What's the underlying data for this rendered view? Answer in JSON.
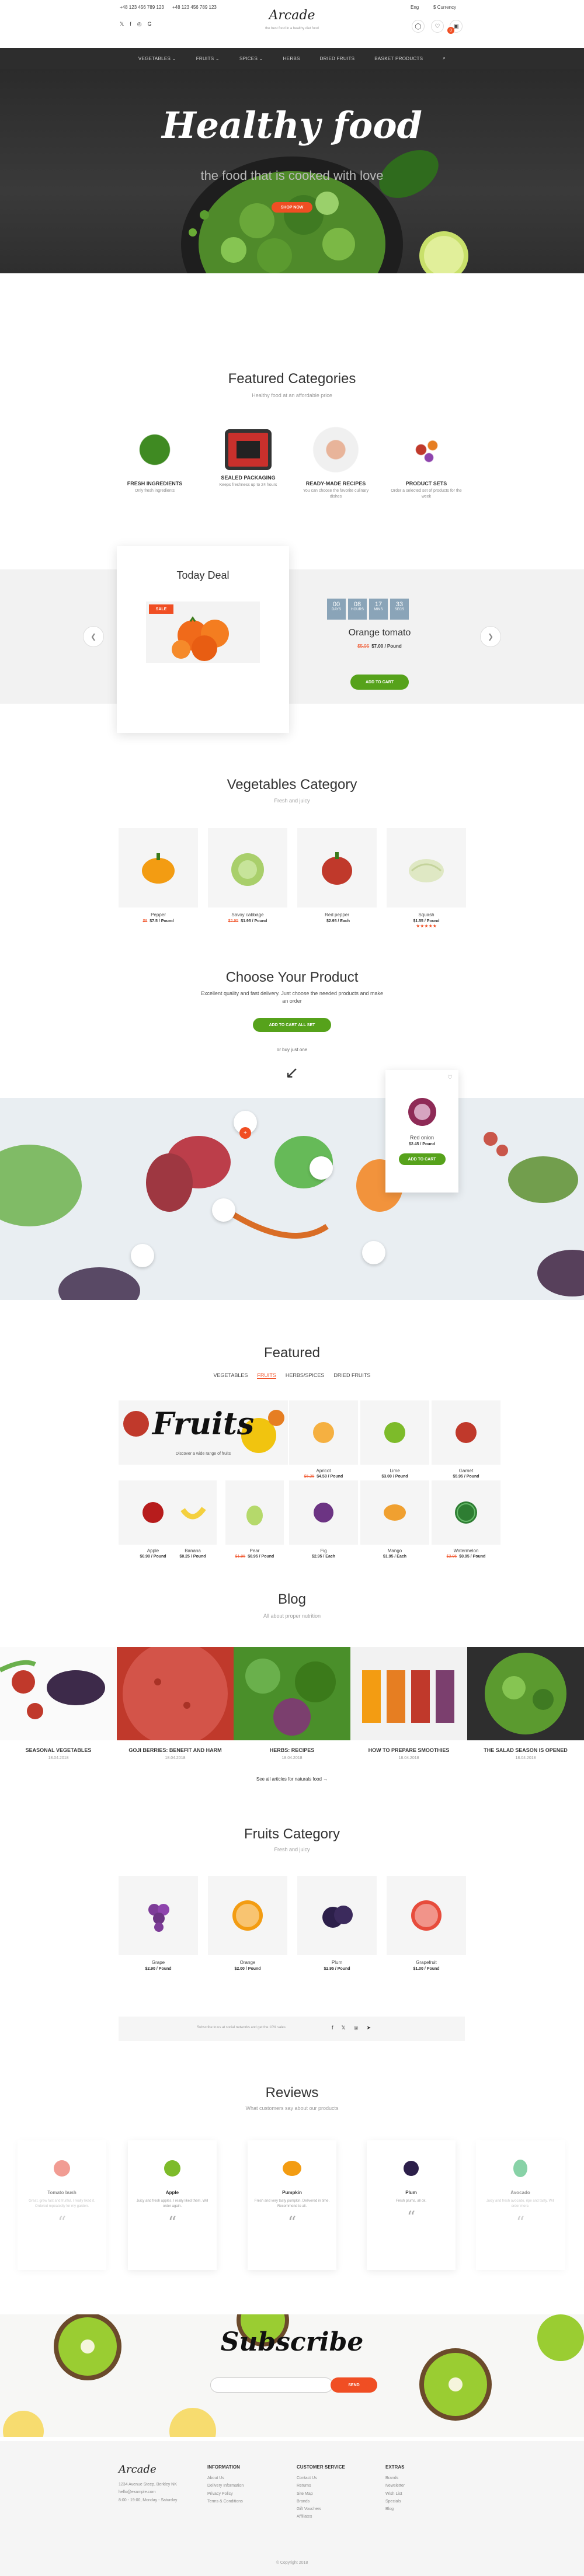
{
  "topbar": {
    "phone1": "+48 123 456 789 123",
    "phone2": "+48 123 456 789 123",
    "logo": "Arcade",
    "tagline": "the best food in a healthy diet food",
    "lang": "Eng",
    "currency": "$ Currency",
    "cart_count": "0"
  },
  "nav": [
    "VEGETABLES ⌄",
    "FRUITS ⌄",
    "SPICES ⌄",
    "HERBS",
    "DRIED FRUITS",
    "BASKET PRODUCTS"
  ],
  "hero": {
    "title": "Healthy food",
    "subtitle": "the food that is cooked with love",
    "button": "SHOP NOW"
  },
  "featured_categories": {
    "title": "Featured Categories",
    "subtitle": "Healthy food at an affordable price",
    "items": [
      {
        "name": "FRESH INGREDIENTS",
        "desc": "Only fresh ingredients"
      },
      {
        "name": "SEALED PACKAGING",
        "desc": "Keeps freshness up to 24 hours"
      },
      {
        "name": "READY-MADE RECIPES",
        "desc": "You can choose the favorite culinary dishes"
      },
      {
        "name": "PRODUCT SETS",
        "desc": "Order a selected set of products for the week"
      }
    ]
  },
  "today_deal": {
    "title": "Today Deal",
    "badge": "SALE",
    "countdown": [
      {
        "v": "00",
        "l": "DAYS"
      },
      {
        "v": "08",
        "l": "HOURS"
      },
      {
        "v": "17",
        "l": "MINS"
      },
      {
        "v": "33",
        "l": "SECS"
      }
    ],
    "product": "Orange tomato",
    "old_price": "$5.95",
    "new_price": "$7.00 / Pound",
    "button": "ADD TO CART"
  },
  "veg_category": {
    "title": "Vegetables Category",
    "subtitle": "Fresh and juicy",
    "items": [
      {
        "name": "Pepper",
        "old": "$8",
        "price": "$7.5 / Pound",
        "stars": ""
      },
      {
        "name": "Savoy cabbage",
        "old": "$2.95",
        "price": "$1.95 / Pound",
        "stars": ""
      },
      {
        "name": "Red pepper",
        "old": "",
        "price": "$2.95 / Each",
        "stars": ""
      },
      {
        "name": "Squash",
        "old": "",
        "price": "$1.55 / Pound",
        "stars": "★★★★★"
      }
    ]
  },
  "choose": {
    "title": "Choose Your Product",
    "desc": "Excellent quality and fast delivery. Just choose the needed products and make an order",
    "button": "ADD TO CART ALL SET",
    "or": "or buy just one",
    "popup_name": "Red onion",
    "popup_price": "$2.45 / Pound",
    "popup_button": "ADD TO CART"
  },
  "featured": {
    "title": "Featured",
    "tabs": [
      "VEGETABLES",
      "FRUITS",
      "HERBS/SPICES",
      "DRIED FRUITS"
    ],
    "banner_title": "Fruits",
    "banner_sub": "Discover a wide range of fruits",
    "items": [
      {
        "name": "Apricot",
        "old": "$5.25",
        "price": "$4.50 / Pound"
      },
      {
        "name": "Lime",
        "old": "",
        "price": "$3.00 / Pound"
      },
      {
        "name": "Garnet",
        "old": "",
        "price": "$5.95 / Pound"
      },
      {
        "name": "Apple",
        "old": "",
        "price": "$0.90 / Pound"
      },
      {
        "name": "Banana",
        "old": "",
        "price": "$0.25 / Pound"
      },
      {
        "name": "Pear",
        "old": "$1.95",
        "price": "$0.95 / Pound"
      },
      {
        "name": "Fig",
        "old": "",
        "price": "$2.95 / Each"
      },
      {
        "name": "Mango",
        "old": "",
        "price": "$1.95 / Each"
      },
      {
        "name": "Watermelon",
        "old": "$2.95",
        "price": "$0.95 / Pound"
      }
    ]
  },
  "blog": {
    "title": "Blog",
    "subtitle": "All about proper nutrition",
    "posts": [
      {
        "title": "SEASONAL VEGETABLES",
        "date": "18.04.2018"
      },
      {
        "title": "GOJI BERRIES: BENEFIT AND HARM",
        "date": "18.04.2018"
      },
      {
        "title": "HERBS: RECIPES",
        "date": "18.04.2018"
      },
      {
        "title": "HOW TO PREPARE SMOOTHIES",
        "date": "18.04.2018"
      },
      {
        "title": "THE SALAD SEASON IS OPENED",
        "date": "18.04.2018"
      }
    ],
    "all": "See all articles for naturals food →"
  },
  "fruits_category": {
    "title": "Fruits Category",
    "subtitle": "Fresh and juicy",
    "items": [
      {
        "name": "Grape",
        "price": "$2.90 / Pound"
      },
      {
        "name": "Orange",
        "price": "$2.00 / Pound"
      },
      {
        "name": "Plum",
        "price": "$2.95 / Pound"
      },
      {
        "name": "Grapefruit",
        "price": "$1.00 / Pound"
      }
    ]
  },
  "subscribe_bar": {
    "text": "Subscribe to us at social networks and get the 10% sales"
  },
  "reviews": {
    "title": "Reviews",
    "subtitle": "What customers say about our products",
    "items": [
      {
        "name": "Tomato bush",
        "text": "Great, grew fast and fruitful. I really liked it. Ordered repeatedly for my garden."
      },
      {
        "name": "Apple",
        "text": "Juicy and fresh apples. I really liked them. Will order again."
      },
      {
        "name": "Pumpkin",
        "text": "Fresh and very tasty pumpkin. Delivered in time. Recommend to all."
      },
      {
        "name": "Plum",
        "text": "Fresh plums, all ok."
      },
      {
        "name": "Avocado",
        "text": "Juicy and fresh avocado, ripe and tasty. Will order more."
      }
    ]
  },
  "subscribe": {
    "title": "Subscribe",
    "placeholder": "",
    "button": "SEND"
  },
  "footer": {
    "logo": "Arcade",
    "address": [
      "1234 Avenue Steep, Berkley NK",
      "hello@example.com",
      "8:00 - 19:00, Monday - Saturday"
    ],
    "cols": [
      {
        "h": "INFORMATION",
        "items": [
          "About Us",
          "Delivery Information",
          "Privacy Policy",
          "Terms & Conditions"
        ]
      },
      {
        "h": "CUSTOMER SERVICE",
        "items": [
          "Contact Us",
          "Returns",
          "Site Map",
          "Brands",
          "Gift Vouchers",
          "Affiliates"
        ]
      },
      {
        "h": "EXTRAS",
        "items": [
          "Brands",
          "Newsletter",
          "Wish List",
          "Specials",
          "Blog"
        ]
      }
    ],
    "copyright": "© Copyright 2018"
  },
  "colors": {
    "accent": "#f04e23",
    "green": "#56a21b",
    "dark": "#2d2d2d"
  }
}
